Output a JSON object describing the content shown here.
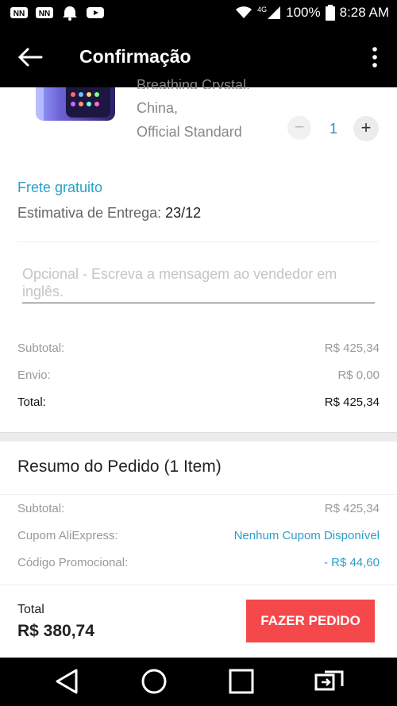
{
  "status_bar": {
    "notifications": [
      "nn-icon",
      "nn-icon",
      "dnd-icon",
      "youtube-icon"
    ],
    "network": "4G",
    "battery": "100%",
    "time": "8:28 AM"
  },
  "app_bar": {
    "title": "Confirmação"
  },
  "product": {
    "variant_partial": "Breathing Crystal,",
    "ship_from": "China,",
    "option": "Official Standard",
    "qty_minus": "−",
    "quantity": "1",
    "qty_plus": "+"
  },
  "shipping": {
    "free_label": "Frete gratuito",
    "delivery_label": "Estimativa de Entrega:",
    "delivery_date": "23/12"
  },
  "message": {
    "placeholder": "Opcional - Escreva a mensagem ao vendedor em inglês."
  },
  "store_totals": {
    "subtotal_label": "Subtotal:",
    "subtotal_value": "R$ 425,34",
    "shipping_label": "Envio:",
    "shipping_value": "R$ 0,00",
    "total_label": "Total:",
    "total_value": "R$ 425,34"
  },
  "summary": {
    "title": "Resumo do Pedido (1 Item)",
    "subtotal_label": "Subtotal:",
    "subtotal_value": "R$ 425,34",
    "coupon_label": "Cupom AliExpress:",
    "coupon_value": "Nenhum Cupom Disponível",
    "promo_label": "Código Promocional:",
    "promo_value": "- R$ 44,60"
  },
  "checkout": {
    "total_label": "Total",
    "total_amount": "R$ 380,74",
    "place_order": "FAZER PEDIDO"
  },
  "colors": {
    "accent": "#2aa0c8",
    "button": "#f5484b"
  }
}
